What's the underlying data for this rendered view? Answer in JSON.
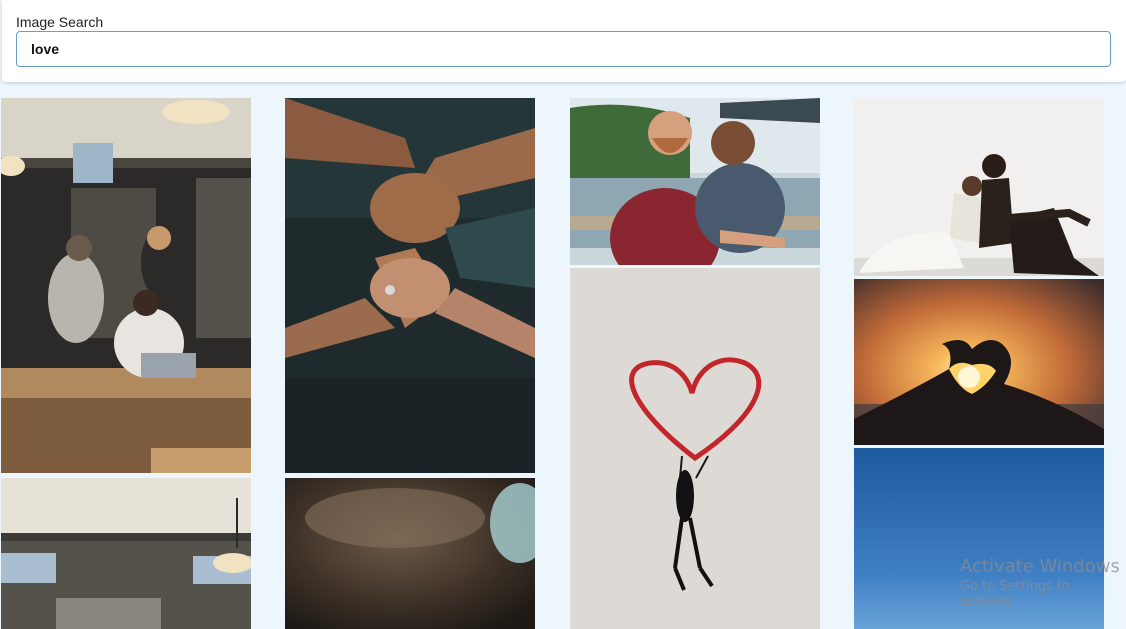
{
  "search": {
    "label": "Image Search",
    "value": "love"
  },
  "results": {
    "images": [
      {
        "id": "img-1",
        "icon": "people-in-cafe-masks-photo"
      },
      {
        "id": "img-2",
        "icon": "holding-hands-photo"
      },
      {
        "id": "img-3",
        "icon": "couple-by-river-photo"
      },
      {
        "id": "img-4",
        "icon": "couple-sitting-back-to-back-photo"
      },
      {
        "id": "img-5",
        "icon": "hands-heart-sunset-photo"
      },
      {
        "id": "img-6",
        "icon": "heart-graffiti-wall-photo"
      },
      {
        "id": "img-7",
        "icon": "blue-sky-photo"
      },
      {
        "id": "img-8",
        "icon": "interior-room-photo"
      },
      {
        "id": "img-9",
        "icon": "blurred-closeup-photo"
      }
    ]
  },
  "watermark": {
    "title": "Activate Windows",
    "subtitle": "Go to Settings to activate"
  }
}
